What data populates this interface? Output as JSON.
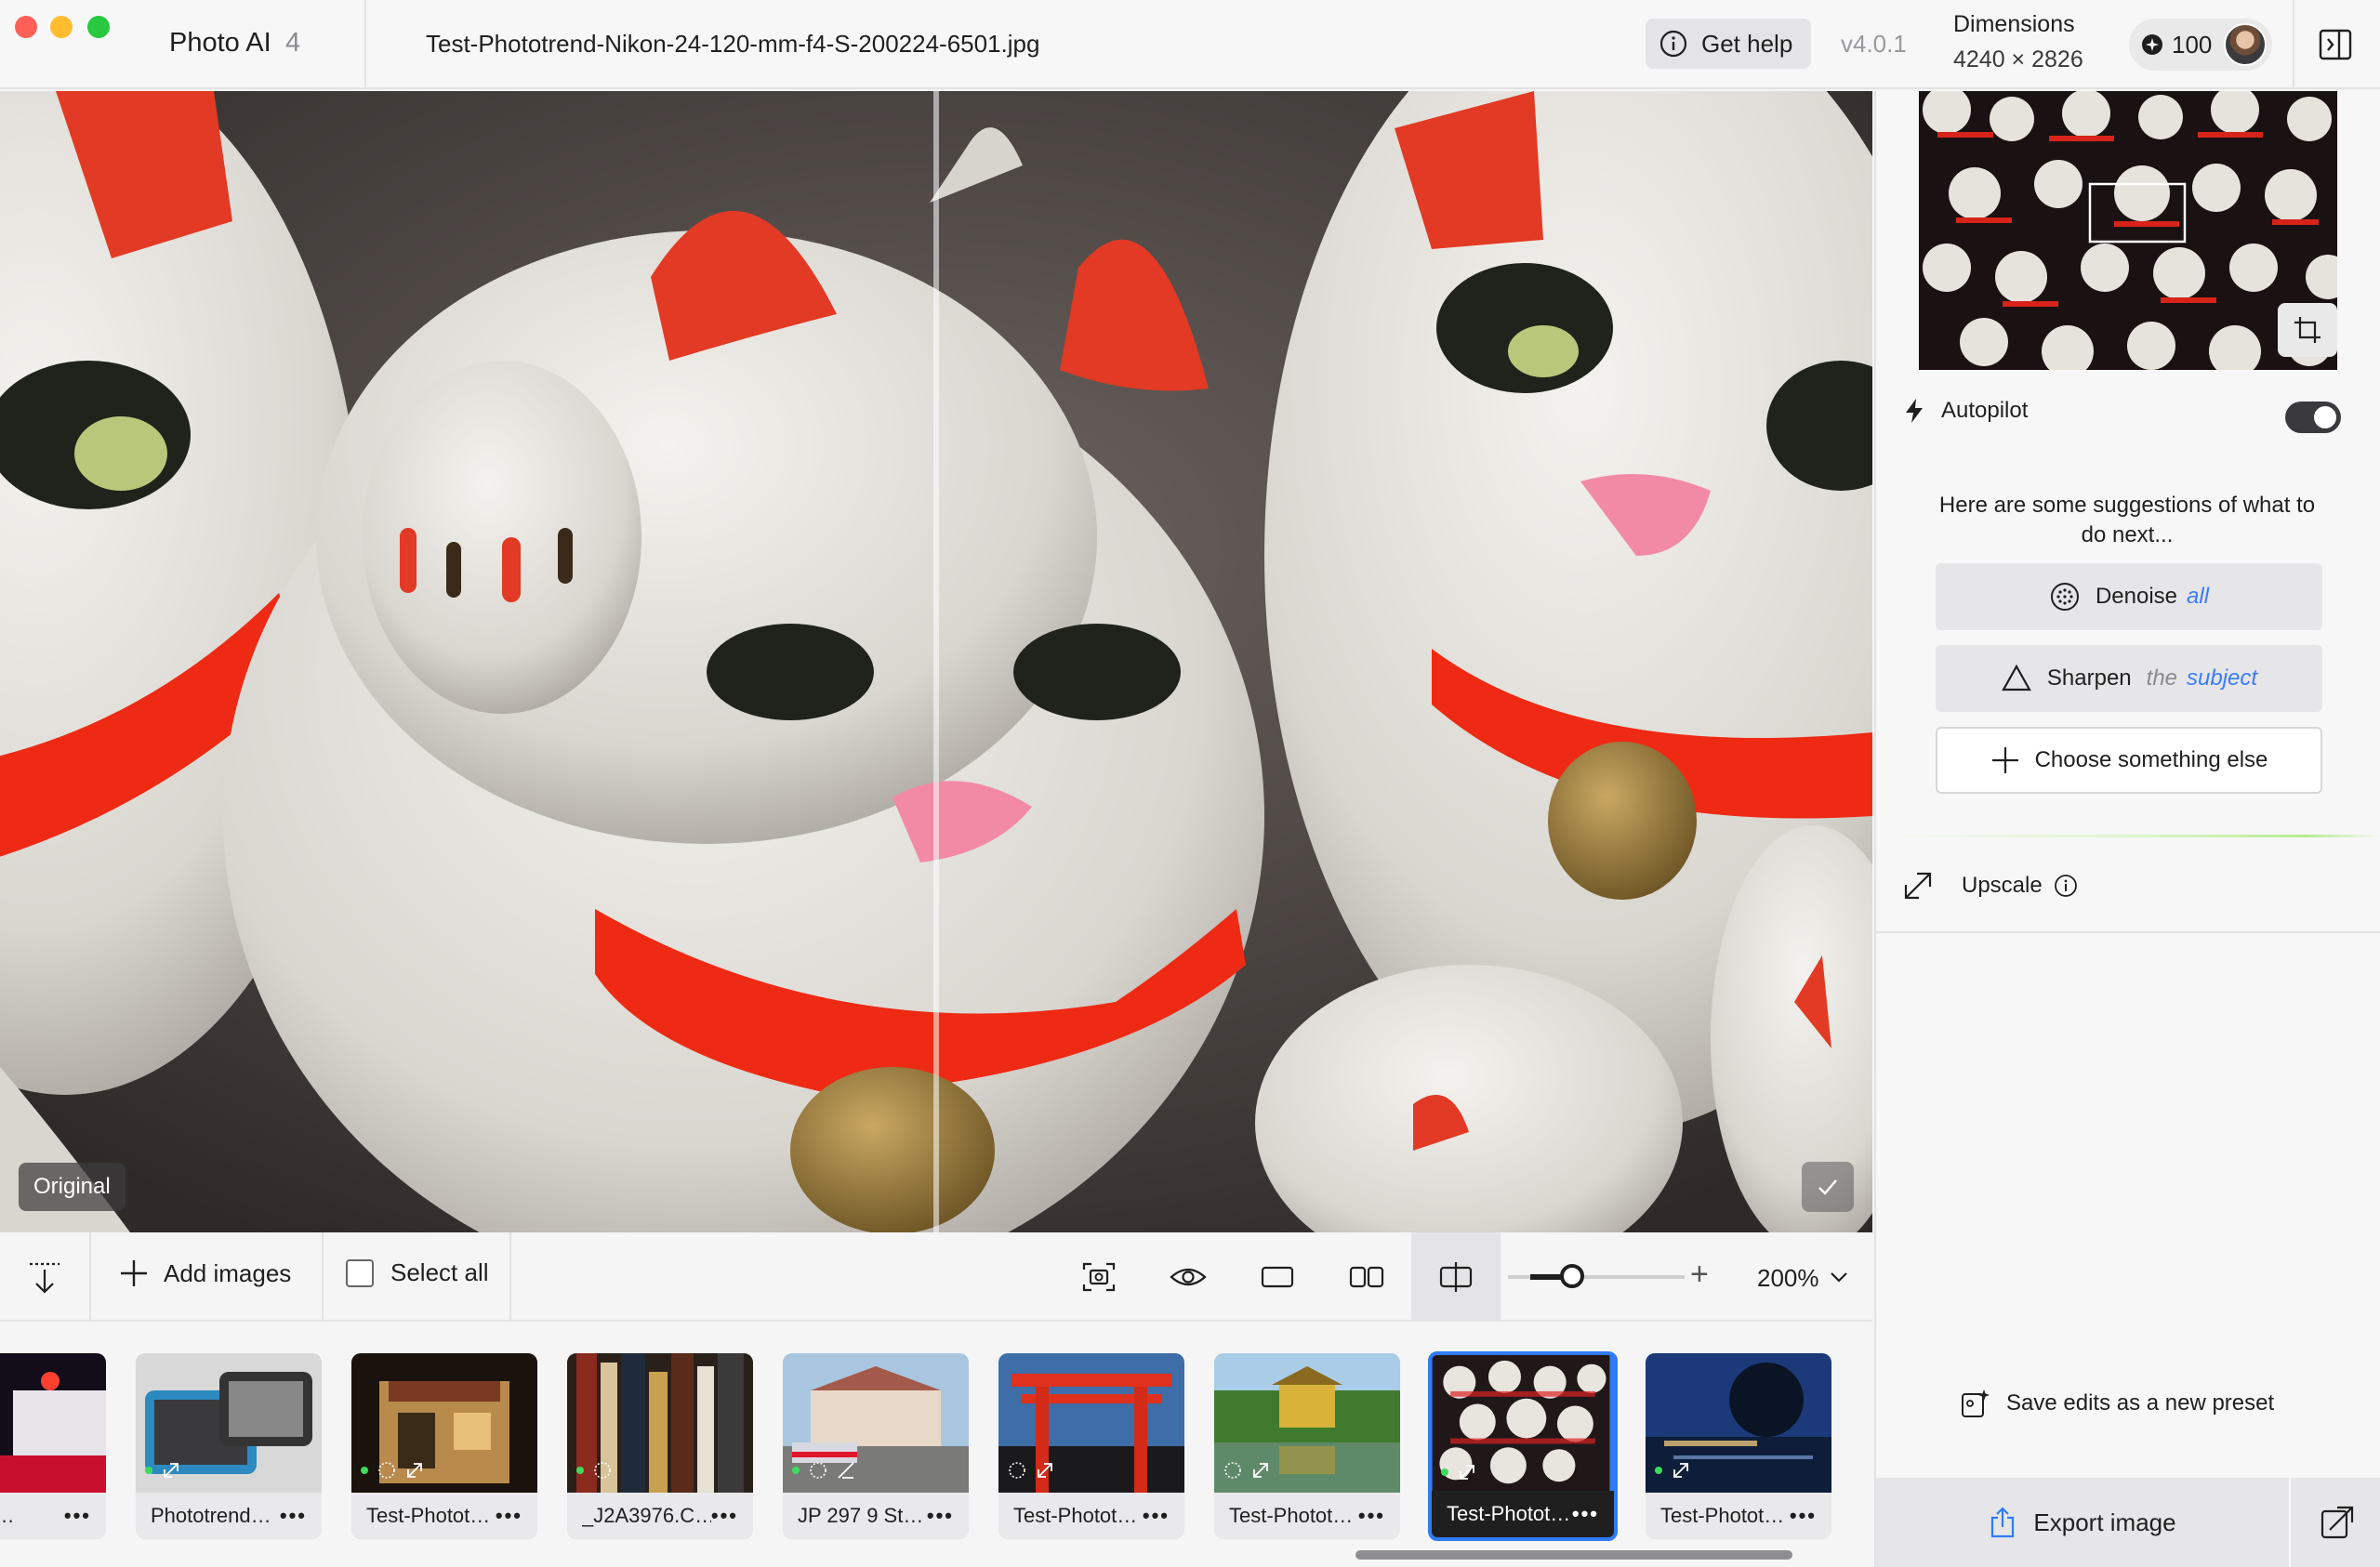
{
  "titlebar": {
    "app_name": "Photo AI",
    "app_major": "4",
    "file_name": "Test-Phototrend-Nikon-24-120-mm-f4-S-200224-6501.jpg",
    "help_label": "Get help",
    "version": "v4.0.1",
    "dimensions_label": "Dimensions",
    "dimensions_value": "4240 × 2826",
    "credits": "100"
  },
  "viewer": {
    "original_label": "Original"
  },
  "toolbar": {
    "add_images": "Add images",
    "select_all": "Select all",
    "zoom_value": "200%",
    "zoom_level_fraction": 0.2
  },
  "filmstrip": {
    "items": [
      {
        "name": "Photot…",
        "selected": false
      },
      {
        "name": "Phototrend…",
        "selected": false
      },
      {
        "name": "Test-Photot…",
        "selected": false
      },
      {
        "name": "_J2A3976.C…",
        "selected": false
      },
      {
        "name": "JP 297 9 St…",
        "selected": false
      },
      {
        "name": "Test-Photot…",
        "selected": false
      },
      {
        "name": "Test-Photot…",
        "selected": false
      },
      {
        "name": "Test-Photot…",
        "selected": true
      },
      {
        "name": "Test-Photot…",
        "selected": false
      }
    ],
    "more": "•••"
  },
  "panel": {
    "autopilot_label": "Autopilot",
    "autopilot_on": true,
    "suggestion_text": "Here are some suggestions of what to do next...",
    "denoise_label": "Denoise",
    "denoise_scope": "all",
    "sharpen_label": "Sharpen",
    "sharpen_the": "the",
    "sharpen_scope": "subject",
    "choose_label": "Choose something else",
    "upscale_label": "Upscale",
    "preset_label": "Save edits as a new preset",
    "export_label": "Export image"
  },
  "colors": {
    "accent_blue": "#2f7cf6",
    "highlight_blue": "#3a7bff",
    "traffic_red": "#fe5f57",
    "traffic_yellow": "#febc2e",
    "traffic_green": "#28c840"
  }
}
